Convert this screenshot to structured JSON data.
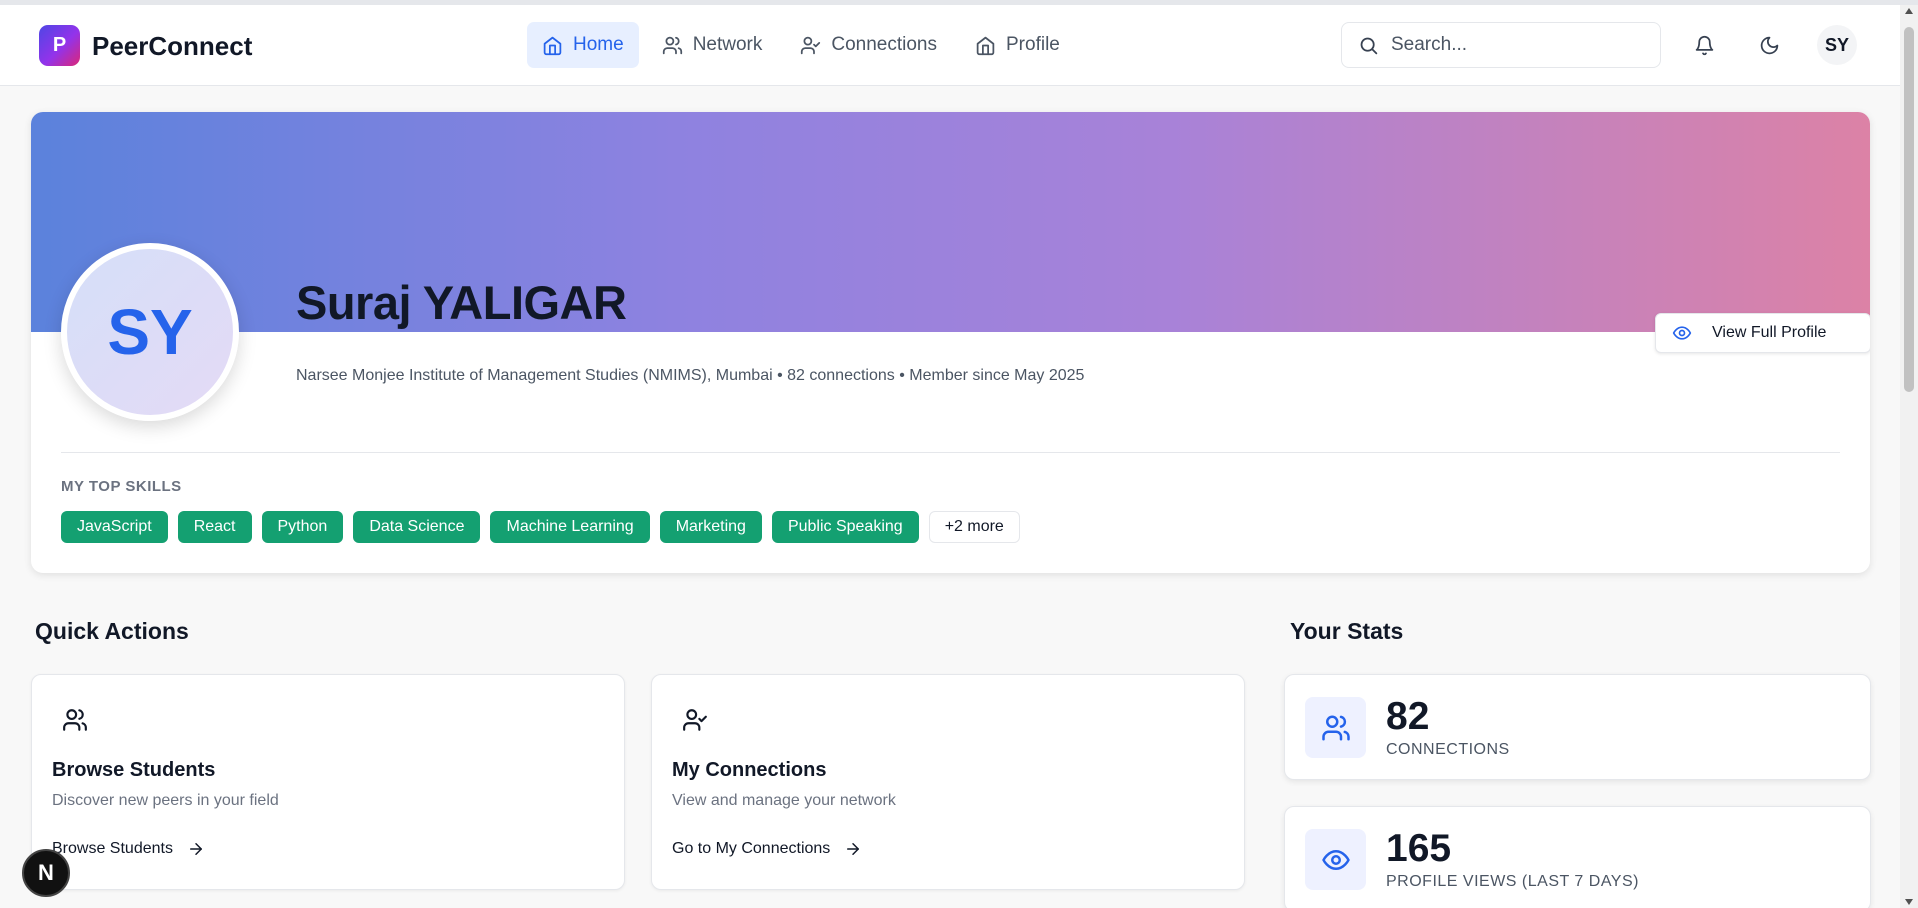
{
  "app": {
    "logo_letter": "P",
    "name": "PeerConnect"
  },
  "nav": {
    "items": [
      {
        "label": "Home",
        "icon": "home-icon",
        "active": true
      },
      {
        "label": "Network",
        "icon": "users-icon",
        "active": false
      },
      {
        "label": "Connections",
        "icon": "user-check-icon",
        "active": false
      },
      {
        "label": "Profile",
        "icon": "home-icon",
        "active": false
      }
    ]
  },
  "search": {
    "placeholder": "Search..."
  },
  "header": {
    "avatar_initials": "SY"
  },
  "profile": {
    "initials": "SY",
    "name": "Suraj YALIGAR",
    "subtitle": "Narsee Monjee Institute of Management Studies (NMIMS), Mumbai • 82 connections • Member since May 2025",
    "view_button": "View Full Profile",
    "skills_label": "MY TOP SKILLS",
    "skills": [
      "JavaScript",
      "React",
      "Python",
      "Data Science",
      "Machine Learning",
      "Marketing",
      "Public Speaking"
    ],
    "more_skills": "+2 more"
  },
  "quick_actions": {
    "title": "Quick Actions",
    "cards": [
      {
        "title": "Browse Students",
        "desc": "Discover new peers in your field",
        "link": "Browse Students",
        "icon": "users-icon"
      },
      {
        "title": "My Connections",
        "desc": "View and manage your network",
        "link": "Go to My Connections",
        "icon": "user-check-icon"
      }
    ]
  },
  "stats": {
    "title": "Your Stats",
    "items": [
      {
        "value": "82",
        "label": "CONNECTIONS",
        "icon": "users-icon"
      },
      {
        "value": "165",
        "label": "PROFILE VIEWS (LAST 7 DAYS)",
        "icon": "eye-icon"
      }
    ]
  },
  "floating": {
    "letter": "N"
  },
  "colors": {
    "accent": "#2563eb",
    "skill_green": "#14a071",
    "nav_active_bg": "#e7efff",
    "banner_start": "#5b82dc",
    "banner_end": "#dc82a6"
  }
}
